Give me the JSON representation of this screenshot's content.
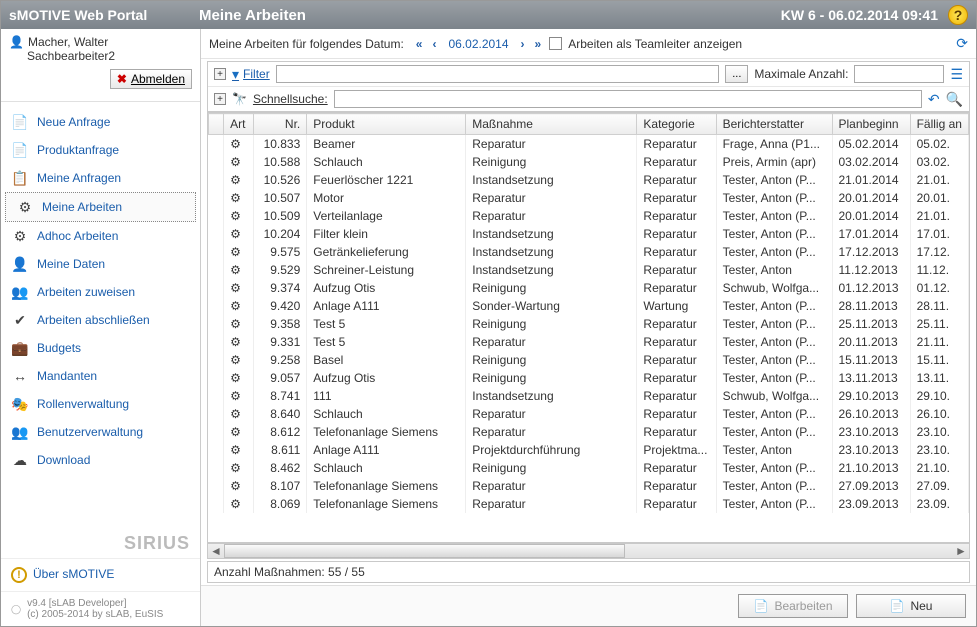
{
  "brand": "sMOTIVE Web Portal",
  "page_title": "Meine Arbeiten",
  "datetime": "KW 6 - 06.02.2014 09:41",
  "user": {
    "name": "Macher, Walter",
    "role": "Sachbearbeiter2",
    "logout": "Abmelden"
  },
  "nav": [
    {
      "label": "Neue Anfrage",
      "icon": "📄"
    },
    {
      "label": "Produktanfrage",
      "icon": "📄"
    },
    {
      "label": "Meine Anfragen",
      "icon": "📋"
    },
    {
      "label": "Meine Arbeiten",
      "icon": "⚙",
      "active": true
    },
    {
      "label": "Adhoc Arbeiten",
      "icon": "⚙"
    },
    {
      "label": "Meine Daten",
      "icon": "👤"
    },
    {
      "label": "Arbeiten zuweisen",
      "icon": "👥"
    },
    {
      "label": "Arbeiten abschließen",
      "icon": "✔"
    },
    {
      "label": "Budgets",
      "icon": "💼"
    },
    {
      "label": "Mandanten",
      "icon": "↔"
    },
    {
      "label": "Rollenverwaltung",
      "icon": "🎭"
    },
    {
      "label": "Benutzerverwaltung",
      "icon": "👥"
    },
    {
      "label": "Download",
      "icon": "☁"
    }
  ],
  "about": "Über sMOTIVE",
  "version": "v9.4 [sLAB Developer]",
  "copyright": "(c) 2005-2014 by sLAB, EuSIS",
  "sirius": "SIRIUS",
  "datebar": {
    "label": "Meine Arbeiten für folgendes Datum:",
    "date": "06.02.2014",
    "teamleader": "Arbeiten als Teamleiter anzeigen"
  },
  "filter": {
    "filter_label": "Filter",
    "ellipsis": "...",
    "max_label": "Maximale Anzahl:",
    "quick_label": "Schnellsuche:"
  },
  "columns": [
    "Art",
    "Nr.",
    "Produkt",
    "Maßnahme",
    "Kategorie",
    "Berichterstatter",
    "Planbeginn",
    "Fällig an"
  ],
  "rows": [
    {
      "nr": "10.833",
      "prod": "Beamer",
      "mass": "Reparatur",
      "kat": "Reparatur",
      "ber": "Frage, Anna (P1...",
      "plan": "05.02.2014",
      "fal": "05.02."
    },
    {
      "nr": "10.588",
      "prod": "Schlauch",
      "mass": "Reinigung",
      "kat": "Reparatur",
      "ber": "Preis, Armin (apr)",
      "plan": "03.02.2014",
      "fal": "03.02."
    },
    {
      "nr": "10.526",
      "prod": "Feuerlöscher 1221",
      "mass": "Instandsetzung",
      "kat": "Reparatur",
      "ber": "Tester, Anton (P...",
      "plan": "21.01.2014",
      "fal": "21.01."
    },
    {
      "nr": "10.507",
      "prod": "Motor",
      "mass": "Reparatur",
      "kat": "Reparatur",
      "ber": "Tester, Anton (P...",
      "plan": "20.01.2014",
      "fal": "20.01."
    },
    {
      "nr": "10.509",
      "prod": "Verteilanlage",
      "mass": "Reparatur",
      "kat": "Reparatur",
      "ber": "Tester, Anton (P...",
      "plan": "20.01.2014",
      "fal": "21.01."
    },
    {
      "nr": "10.204",
      "prod": "Filter klein",
      "mass": "Instandsetzung",
      "kat": "Reparatur",
      "ber": "Tester, Anton (P...",
      "plan": "17.01.2014",
      "fal": "17.01."
    },
    {
      "nr": "9.575",
      "prod": "Getränkelieferung",
      "mass": "Instandsetzung",
      "kat": "Reparatur",
      "ber": "Tester, Anton (P...",
      "plan": "17.12.2013",
      "fal": "17.12."
    },
    {
      "nr": "9.529",
      "prod": "Schreiner-Leistung",
      "mass": "Instandsetzung",
      "kat": "Reparatur",
      "ber": "Tester, Anton",
      "plan": "11.12.2013",
      "fal": "11.12."
    },
    {
      "nr": "9.374",
      "prod": "Aufzug Otis",
      "mass": "Reinigung",
      "kat": "Reparatur",
      "ber": "Schwub, Wolfga...",
      "plan": "01.12.2013",
      "fal": "01.12."
    },
    {
      "nr": "9.420",
      "prod": "Anlage A111",
      "mass": "Sonder-Wartung",
      "kat": "Wartung",
      "ber": "Tester, Anton (P...",
      "plan": "28.11.2013",
      "fal": "28.11."
    },
    {
      "nr": "9.358",
      "prod": "Test 5",
      "mass": "Reinigung",
      "kat": "Reparatur",
      "ber": "Tester, Anton (P...",
      "plan": "25.11.2013",
      "fal": "25.11."
    },
    {
      "nr": "9.331",
      "prod": "Test 5",
      "mass": "Reparatur",
      "kat": "Reparatur",
      "ber": "Tester, Anton (P...",
      "plan": "20.11.2013",
      "fal": "21.11."
    },
    {
      "nr": "9.258",
      "prod": "Basel",
      "mass": "Reinigung",
      "kat": "Reparatur",
      "ber": "Tester, Anton (P...",
      "plan": "15.11.2013",
      "fal": "15.11."
    },
    {
      "nr": "9.057",
      "prod": "Aufzug Otis",
      "mass": "Reinigung",
      "kat": "Reparatur",
      "ber": "Tester, Anton (P...",
      "plan": "13.11.2013",
      "fal": "13.11."
    },
    {
      "nr": "8.741",
      "prod": "111",
      "mass": "Instandsetzung",
      "kat": "Reparatur",
      "ber": "Schwub, Wolfga...",
      "plan": "29.10.2013",
      "fal": "29.10."
    },
    {
      "nr": "8.640",
      "prod": "Schlauch",
      "mass": "Reparatur",
      "kat": "Reparatur",
      "ber": "Tester, Anton (P...",
      "plan": "26.10.2013",
      "fal": "26.10."
    },
    {
      "nr": "8.612",
      "prod": "Telefonanlage Siemens",
      "mass": "Reparatur",
      "kat": "Reparatur",
      "ber": "Tester, Anton (P...",
      "plan": "23.10.2013",
      "fal": "23.10."
    },
    {
      "nr": "8.611",
      "prod": "Anlage A111",
      "mass": "Projektdurchführung",
      "kat": "Projektma...",
      "ber": "Tester, Anton",
      "plan": "23.10.2013",
      "fal": "23.10."
    },
    {
      "nr": "8.462",
      "prod": "Schlauch",
      "mass": "Reinigung",
      "kat": "Reparatur",
      "ber": "Tester, Anton (P...",
      "plan": "21.10.2013",
      "fal": "21.10."
    },
    {
      "nr": "8.107",
      "prod": "Telefonanlage Siemens",
      "mass": "Reparatur",
      "kat": "Reparatur",
      "ber": "Tester, Anton (P...",
      "plan": "27.09.2013",
      "fal": "27.09."
    },
    {
      "nr": "8.069",
      "prod": "Telefonanlage Siemens",
      "mass": "Reparatur",
      "kat": "Reparatur",
      "ber": "Tester, Anton (P...",
      "plan": "23.09.2013",
      "fal": "23.09."
    }
  ],
  "count": "Anzahl Maßnahmen: 55 / 55",
  "actions": {
    "edit": "Bearbeiten",
    "new": "Neu"
  }
}
